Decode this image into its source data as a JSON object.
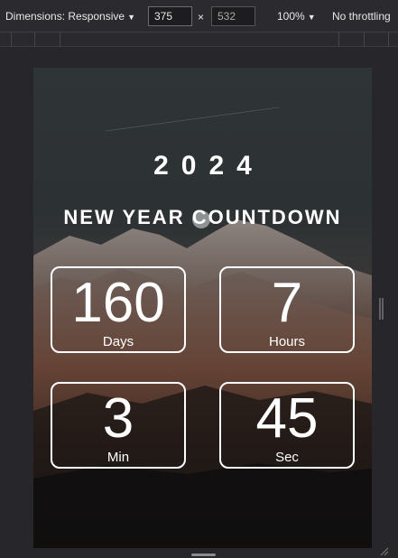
{
  "toolbar": {
    "dimensions_label": "Dimensions: Responsive",
    "width_value": "375",
    "times": "×",
    "height_value": "532",
    "zoom": "100%",
    "throttle": "No throttling"
  },
  "page": {
    "year": "2024",
    "headline": "NEW YEAR COUNTDOWN",
    "countdown": [
      {
        "value": "160",
        "unit": "Days"
      },
      {
        "value": "7",
        "unit": "Hours"
      },
      {
        "value": "3",
        "unit": "Min"
      },
      {
        "value": "45",
        "unit": "Sec"
      }
    ]
  },
  "colors": {
    "toolbar_bg": "#2b2b2f",
    "text": "#ffffff",
    "sky": "#2f3436",
    "mountain_red": "#5a3c30"
  }
}
